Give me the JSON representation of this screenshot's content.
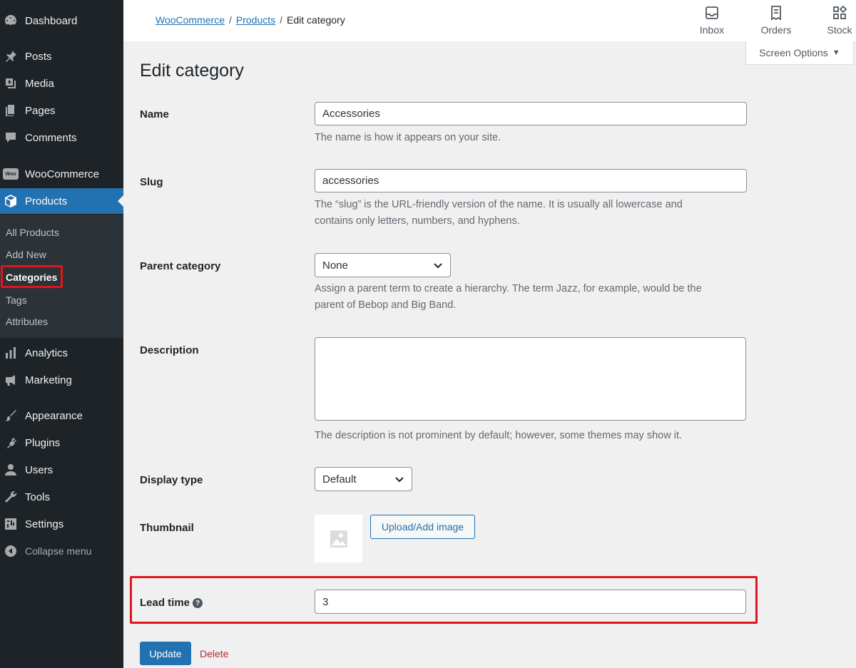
{
  "sidebar": {
    "items": [
      {
        "label": "Dashboard",
        "icon": "dashboard-icon"
      },
      {
        "label": "Posts",
        "icon": "pin-icon"
      },
      {
        "label": "Media",
        "icon": "media-icon"
      },
      {
        "label": "Pages",
        "icon": "pages-icon"
      },
      {
        "label": "Comments",
        "icon": "comment-icon"
      },
      {
        "label": "WooCommerce",
        "icon": "woo-icon"
      },
      {
        "label": "Products",
        "icon": "box-icon"
      },
      {
        "label": "Analytics",
        "icon": "chart-icon"
      },
      {
        "label": "Marketing",
        "icon": "megaphone-icon"
      },
      {
        "label": "Appearance",
        "icon": "brush-icon"
      },
      {
        "label": "Plugins",
        "icon": "plug-icon"
      },
      {
        "label": "Users",
        "icon": "user-icon"
      },
      {
        "label": "Tools",
        "icon": "wrench-icon"
      },
      {
        "label": "Settings",
        "icon": "settings-icon"
      }
    ],
    "submenu": [
      "All Products",
      "Add New",
      "Categories",
      "Tags",
      "Attributes"
    ],
    "collapse_label": "Collapse menu",
    "woo_badge": "Woo"
  },
  "header": {
    "breadcrumb": [
      "WooCommerce",
      "Products",
      "Edit category"
    ],
    "breadcrumb_sep": "/",
    "buttons": [
      "Inbox",
      "Orders",
      "Stock"
    ],
    "screen_options": "Screen Options"
  },
  "main": {
    "title": "Edit category",
    "name": {
      "label": "Name",
      "value": "Accessories",
      "help": "The name is how it appears on your site."
    },
    "slug": {
      "label": "Slug",
      "value": "accessories",
      "help_line1": "The “slug” is the URL-friendly version of the name. It is usually all lowercase and",
      "help_line2": "contains only letters, numbers, and hyphens."
    },
    "parent": {
      "label": "Parent category",
      "value": "None",
      "help_line1": "Assign a parent term to create a hierarchy. The term Jazz, for example, would be the",
      "help_line2": "parent of Bebop and Big Band."
    },
    "description": {
      "label": "Description",
      "value": "",
      "help": "The description is not prominent by default; however, some themes may show it."
    },
    "display_type": {
      "label": "Display type",
      "value": "Default"
    },
    "thumbnail": {
      "label": "Thumbnail",
      "button": "Upload/Add image"
    },
    "lead_time": {
      "label": "Lead time",
      "help_glyph": "?",
      "value": "3"
    },
    "update_label": "Update",
    "delete_label": "Delete"
  },
  "colors": {
    "accent": "#2271b1",
    "sidebar": "#1d2327",
    "highlight": "#e2141e"
  }
}
